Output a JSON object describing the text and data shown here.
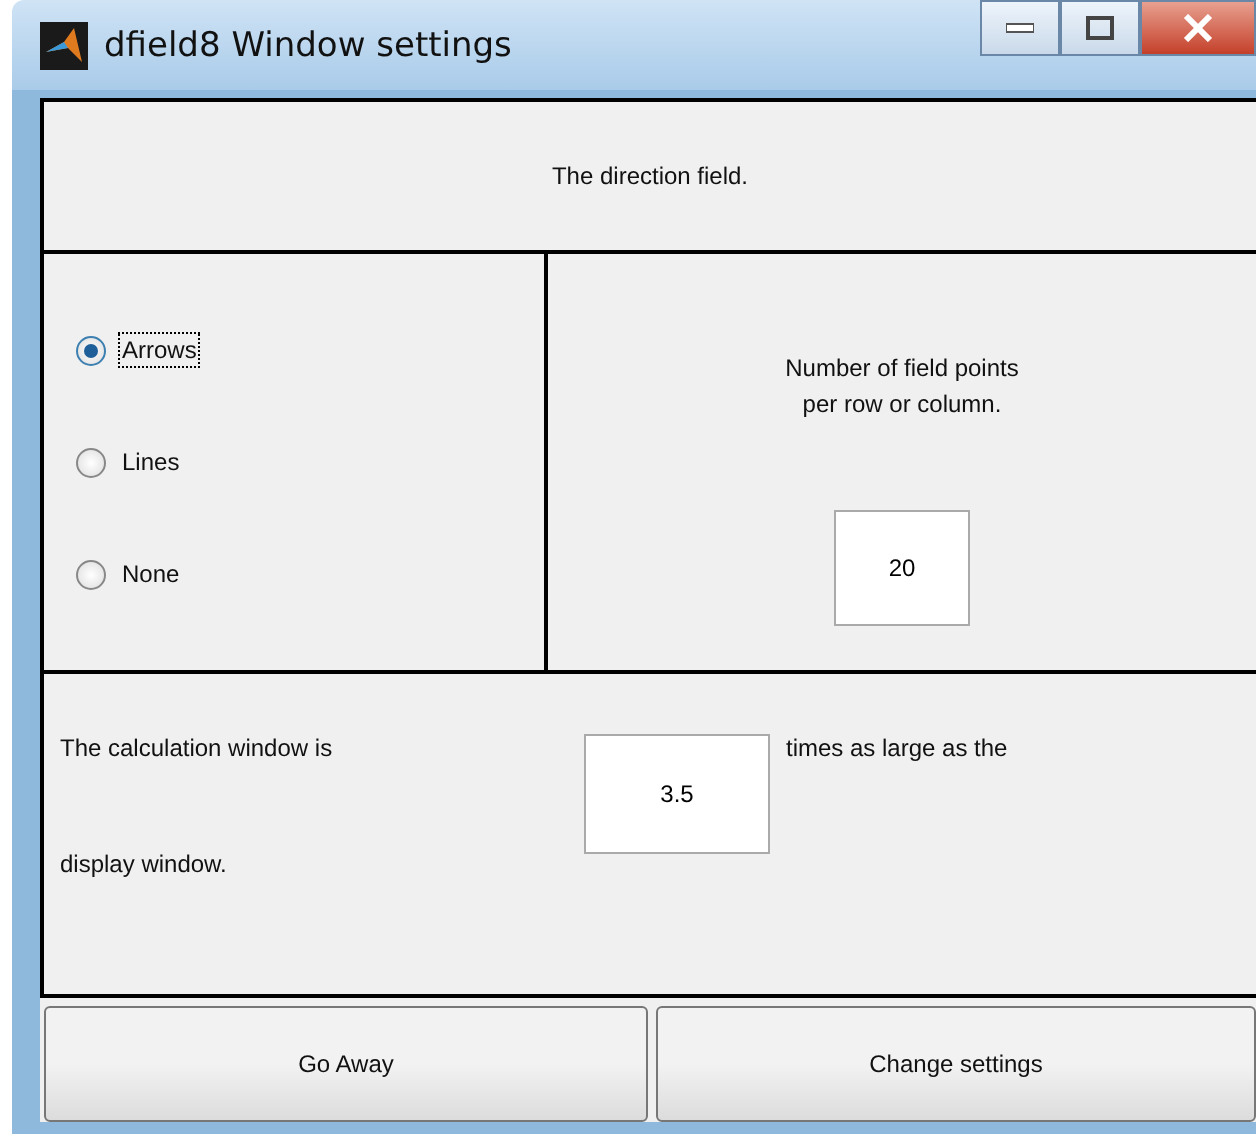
{
  "window": {
    "title": "dfield8 Window settings"
  },
  "header": {
    "text": "The direction field."
  },
  "display_options": [
    {
      "label": "Arrows",
      "selected": true
    },
    {
      "label": "Lines",
      "selected": false
    },
    {
      "label": "None",
      "selected": false
    }
  ],
  "field_points": {
    "label": "Number of field points\nper row or column.",
    "value": "20"
  },
  "calculation": {
    "text_before": "The calculation window is",
    "value": "3.5",
    "text_after": "times as large as the",
    "text_end": "display window."
  },
  "buttons": [
    "Go Away",
    "Change settings"
  ]
}
